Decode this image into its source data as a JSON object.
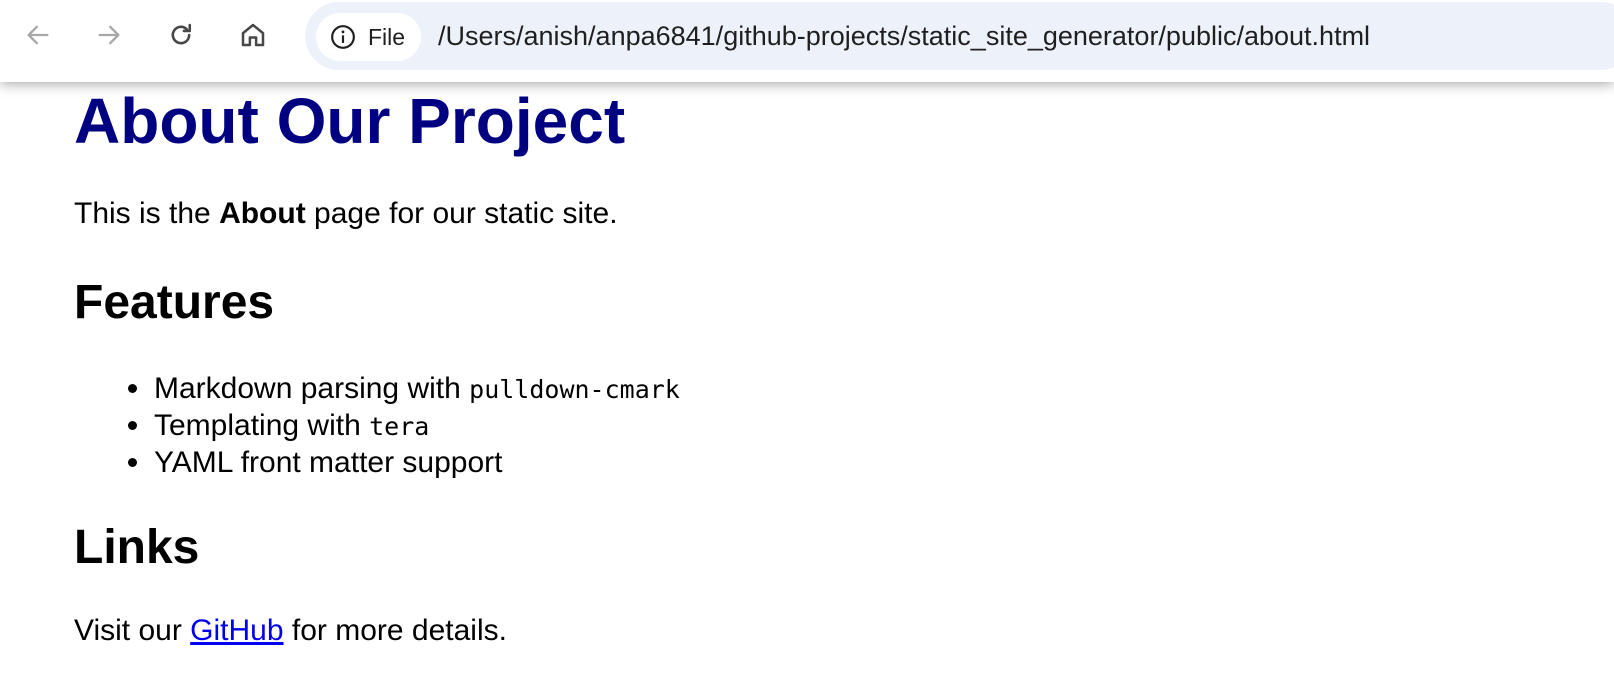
{
  "browser": {
    "chip_label": "File",
    "url": "/Users/anish/anpa6841/github-projects/static_site_generator/public/about.html",
    "icons": {
      "back": "arrow-left-icon",
      "forward": "arrow-right-icon",
      "reload": "reload-icon",
      "home": "home-icon",
      "site_info": "info-icon"
    }
  },
  "page": {
    "title": "About Our Project",
    "title_color": "#000080",
    "intro": {
      "before": "This is the ",
      "bold": "About",
      "after": " page for our static site."
    },
    "features_heading": "Features",
    "features": [
      {
        "text": "Markdown parsing with ",
        "code": "pulldown-cmark"
      },
      {
        "text": "Templating with ",
        "code": "tera"
      },
      {
        "text": "YAML front matter support",
        "code": ""
      }
    ],
    "links_heading": "Links",
    "visit": {
      "before": "Visit our ",
      "link_text": "GitHub",
      "after": " for more details.",
      "link_color": "#0000ee"
    }
  }
}
